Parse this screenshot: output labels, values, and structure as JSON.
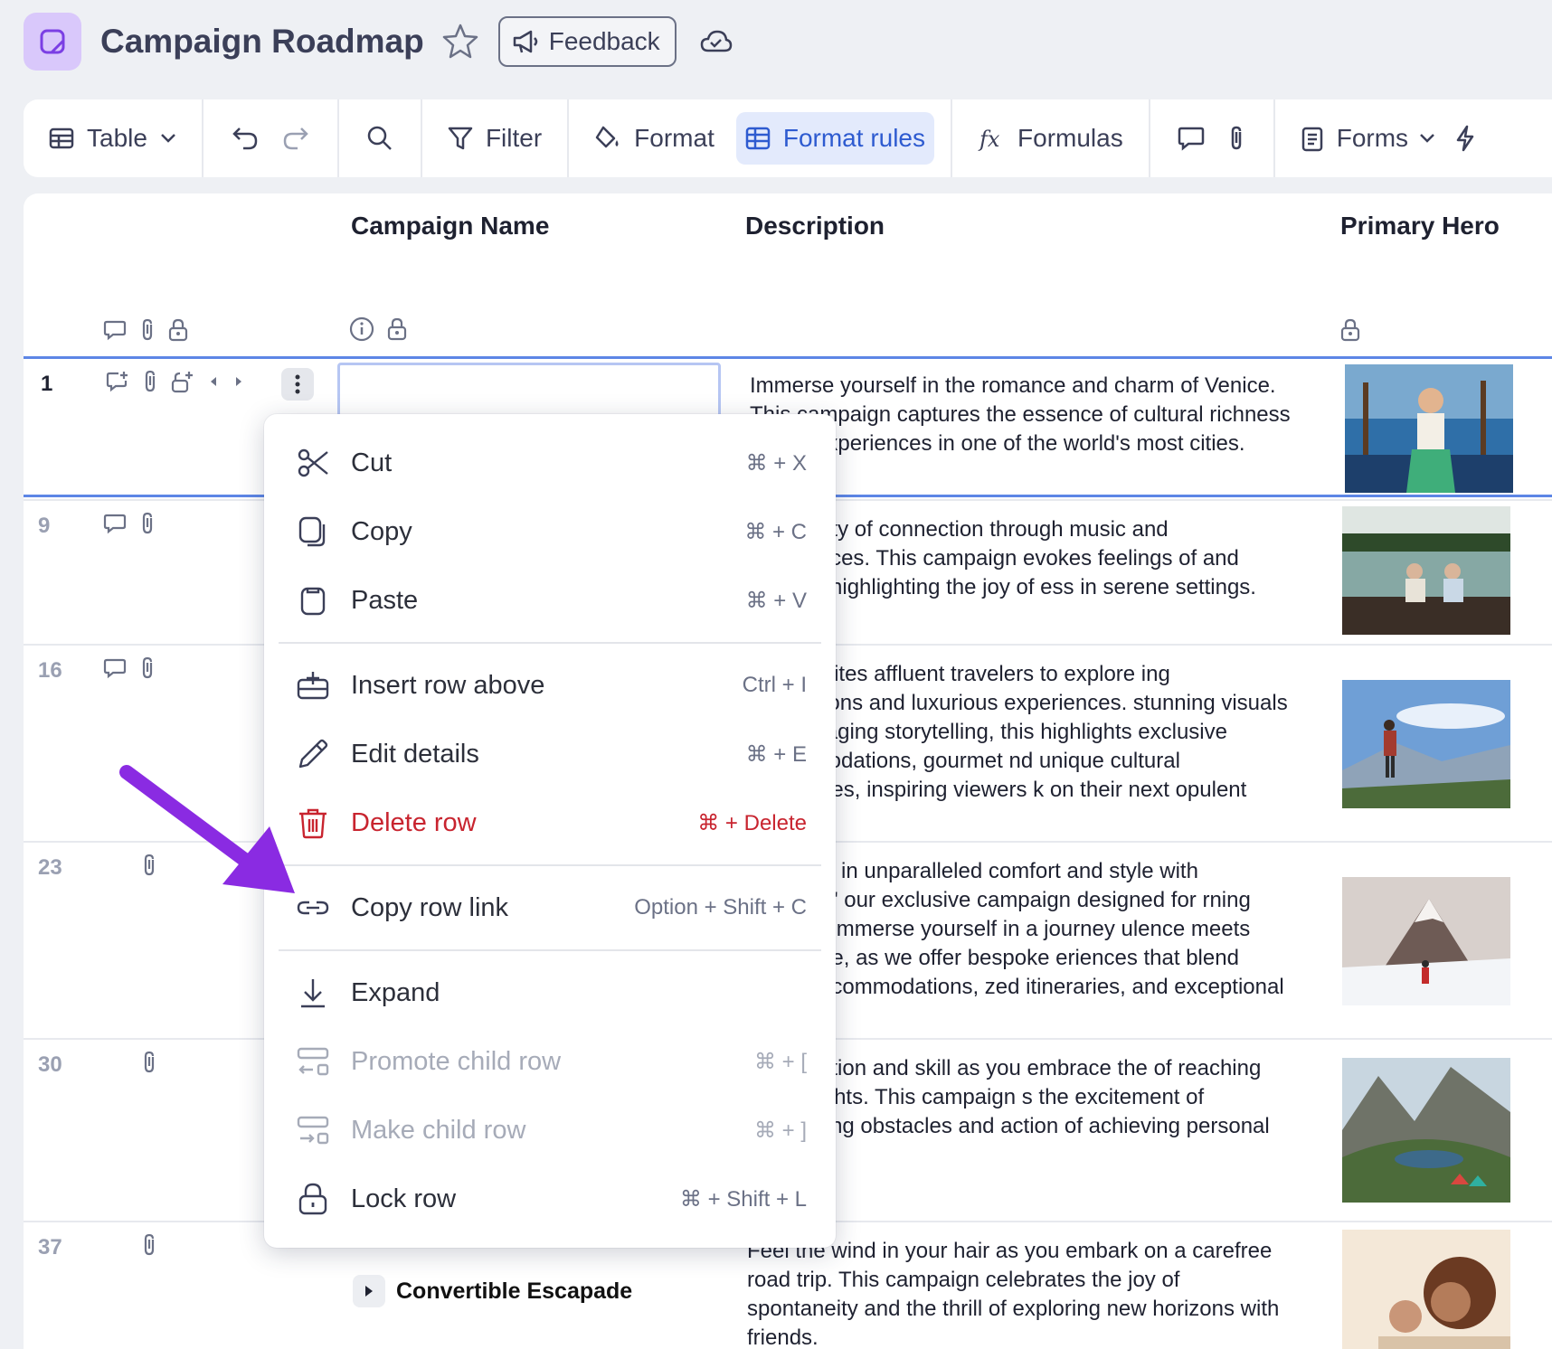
{
  "app": {
    "title": "Campaign Roadmap",
    "feedback_label": "Feedback"
  },
  "toolbar": {
    "table_label": "Table",
    "filter_label": "Filter",
    "format_label": "Format",
    "format_rules_label": "Format rules",
    "formulas_label": "Formulas",
    "forms_label": "Forms"
  },
  "columns": {
    "campaign_name": "Campaign Name",
    "description": "Description",
    "primary_hero": "Primary Hero"
  },
  "rows": [
    {
      "num": "1",
      "description": "Immerse yourself in the romance and charm of Venice. This campaign captures the essence of cultural richness anting experiences in one of the world's most cities."
    },
    {
      "num": "9",
      "description": "the beauty of connection through music and experiences. This campaign evokes feelings of and warmth, highlighting the joy of ess in serene settings."
    },
    {
      "num": "16",
      "description": "paign invites affluent travelers to explore ing destinations and luxurious experiences. stunning visuals and engaging storytelling, this highlights exclusive accommodations, gourmet nd unique cultural adventures, inspiring viewers k on their next opulent getaway."
    },
    {
      "num": "23",
      "description": "the world in unparalleled comfort and style with nderlust,\" our exclusive campaign designed for rning traveler. Immerse yourself in a journey ulence meets adventure, as we offer bespoke eriences that blend lavish accommodations, zed itineraries, and exceptional service."
    },
    {
      "num": "30",
      "description": "etermination and skill as you embrace the of reaching new heights. This campaign s the excitement of conquering obstacles and action of achieving personal goals."
    },
    {
      "num": "37",
      "campaign_name": "Convertible Escapade",
      "description": "Feel the wind in your hair as you embark on a carefree road trip. This campaign celebrates the joy of spontaneity and the thrill of exploring new horizons with friends."
    }
  ],
  "context_menu": {
    "items": [
      {
        "label": "Cut",
        "shortcut": "⌘ + X"
      },
      {
        "label": "Copy",
        "shortcut": "⌘ + C"
      },
      {
        "label": "Paste",
        "shortcut": "⌘ + V"
      },
      {
        "label": "Insert row above",
        "shortcut": "Ctrl + I"
      },
      {
        "label": "Edit details",
        "shortcut": "⌘ + E"
      },
      {
        "label": "Delete row",
        "shortcut": "⌘ + Delete"
      },
      {
        "label": "Copy row link",
        "shortcut": "Option + Shift + C"
      },
      {
        "label": "Expand",
        "shortcut": ""
      },
      {
        "label": "Promote child row",
        "shortcut": "⌘ + ["
      },
      {
        "label": "Make child row",
        "shortcut": "⌘ + ]"
      },
      {
        "label": "Lock row",
        "shortcut": "⌘ + Shift + L"
      }
    ]
  },
  "colors": {
    "accent": "#2e5bd0",
    "danger": "#c8242f",
    "annotation_arrow": "#8a2be2"
  }
}
